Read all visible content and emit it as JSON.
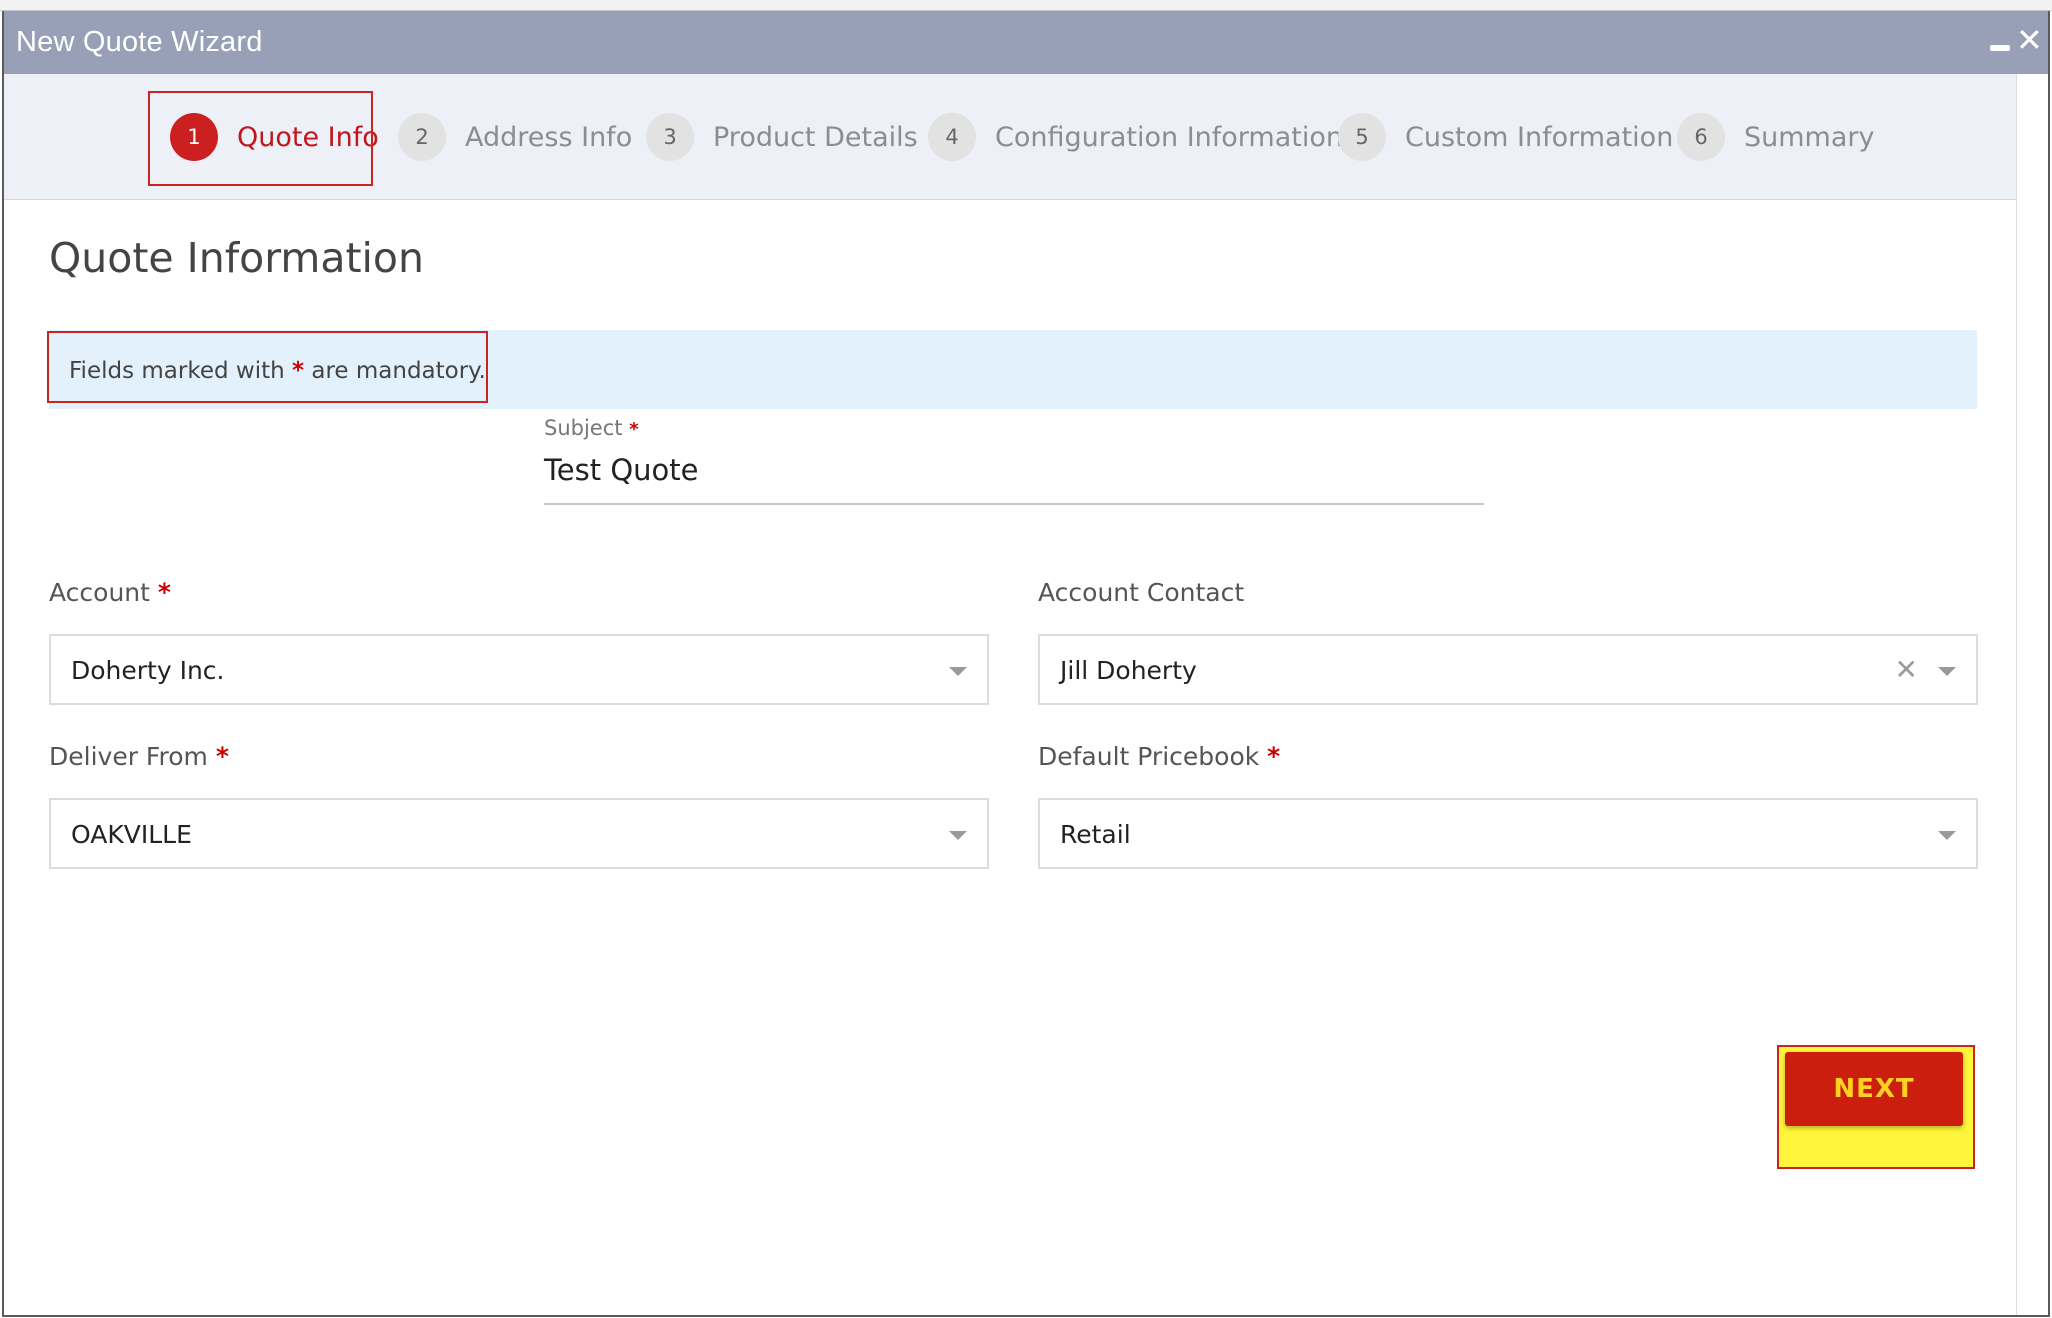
{
  "window": {
    "title": "New Quote Wizard"
  },
  "steps": [
    {
      "num": "1",
      "label": "Quote Info"
    },
    {
      "num": "2",
      "label": "Address Info"
    },
    {
      "num": "3",
      "label": "Product Details"
    },
    {
      "num": "4",
      "label": "Configuration Information"
    },
    {
      "num": "5",
      "label": "Custom Information"
    },
    {
      "num": "6",
      "label": "Summary"
    }
  ],
  "page": {
    "title": "Quote Information"
  },
  "info": {
    "before": "Fields marked with ",
    "asterisk": "*",
    "after": " are mandatory."
  },
  "subject": {
    "label": "Subject",
    "asterisk": "*",
    "value": "Test Quote"
  },
  "fields": {
    "account": {
      "label": "Account",
      "asterisk": "*",
      "value": "Doherty Inc."
    },
    "account_contact": {
      "label": "Account Contact",
      "value": "Jill Doherty"
    },
    "deliver_from": {
      "label": "Deliver From",
      "asterisk": "*",
      "value": "OAKVILLE"
    },
    "default_pricebook": {
      "label": "Default Pricebook",
      "asterisk": "*",
      "value": "Retail"
    }
  },
  "actions": {
    "next_label": "NEXT"
  },
  "colors": {
    "accent": "#cc1e0c",
    "highlight": "#fff53a",
    "titlebar": "#98a0b8",
    "info_bg": "#e3f1fc"
  }
}
